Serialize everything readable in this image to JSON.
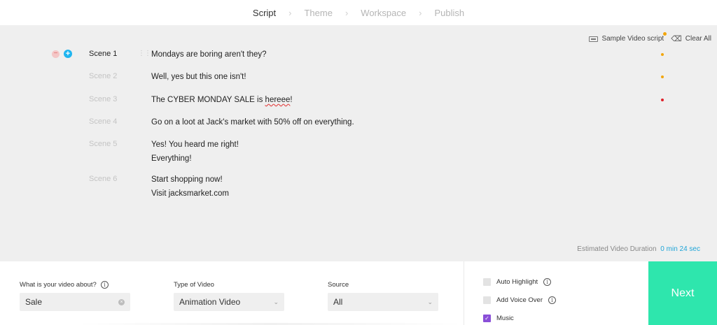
{
  "stepper": {
    "steps": [
      "Script",
      "Theme",
      "Workspace",
      "Publish"
    ],
    "active_index": 0,
    "separator_icon": "chevron-right-icon"
  },
  "toolbar": {
    "sample_label": "Sample Video script",
    "clear_label": "Clear All",
    "notification_color": "#f2a60c"
  },
  "scenes": [
    {
      "label": "Scene 1",
      "lines": [
        "Mondays are boring aren't they?"
      ],
      "status_color": "#f2a60c",
      "active": true
    },
    {
      "label": "Scene 2",
      "lines": [
        "Well, yes but this one isn't!"
      ],
      "status_color": "#f2a60c",
      "active": false
    },
    {
      "label": "Scene 3",
      "lines": [
        "The CYBER MONDAY SALE is ",
        "hereee",
        "!"
      ],
      "status_color": "#e0202a",
      "active": false
    },
    {
      "label": "Scene 4",
      "lines": [
        "Go on a loot at Jack's market with 50% off on everything."
      ],
      "status_color": "",
      "active": false
    },
    {
      "label": "Scene 5",
      "lines": [
        "Yes! You heard me right!",
        "Everything!"
      ],
      "status_color": "",
      "active": false
    },
    {
      "label": "Scene 6",
      "lines": [
        "Start shopping now!",
        "Visit jacksmarket.com"
      ],
      "status_color": "",
      "active": false
    }
  ],
  "duration": {
    "label": "Estimated Video Duration",
    "value": "0 min 24 sec"
  },
  "form": {
    "topic_label": "What is your video about?",
    "topic_value": "Sale",
    "type_label": "Type of Video",
    "type_value": "Animation Video",
    "source_label": "Source",
    "source_value": "All"
  },
  "options": {
    "auto_highlight": {
      "label": "Auto Highlight",
      "checked": false
    },
    "voice_over": {
      "label": "Add Voice Over",
      "checked": false
    },
    "music": {
      "label": "Music",
      "checked": true
    }
  },
  "next_label": "Next",
  "colors": {
    "accent_blue": "#1fb5f0",
    "next_green": "#2ee6ad",
    "checkbox_purple": "#8a4fd8"
  }
}
